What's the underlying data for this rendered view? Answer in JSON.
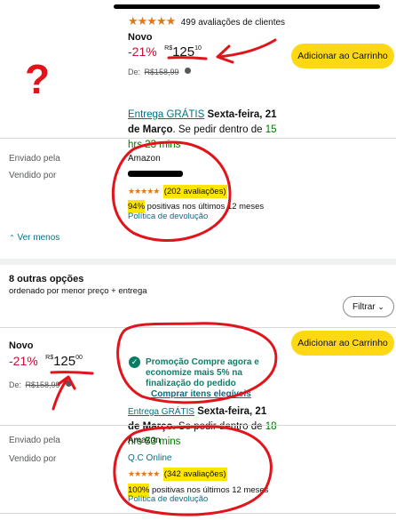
{
  "top_offer": {
    "rating_stars": "★★★★★",
    "rating_count": "499 avaliações de clientes",
    "condition": "Novo",
    "discount": "-21%",
    "currency": "R$",
    "price_whole": "125",
    "price_cents": "10",
    "list_price_label": "De:",
    "list_price": "R$158,99",
    "add_to_cart": "Adicionar ao Carrinho",
    "delivery_free": "Entrega GRÁTIS",
    "delivery_date": "Sexta-feira, 21 de Março",
    "delivery_order_text": ". Se pedir dentro de ",
    "delivery_countdown": "15 hrs 23 mins",
    "shipped_by_label": "Enviado pela",
    "shipped_by_value": "Amazon",
    "sold_by_label": "Vendido por",
    "sold_by_value": "",
    "seller_stars": "★★★★★",
    "seller_reviews": "(202 avaliações)",
    "seller_positive_pct": "94%",
    "seller_positive_text": " positivas nos últimos 12 meses",
    "return_policy": "Política de devolução",
    "see_less": "Ver menos"
  },
  "other_options": {
    "title": "8 outras opções",
    "subtitle": "ordenado por menor preço + entrega",
    "filter_label": "Filtrar"
  },
  "second_offer": {
    "condition": "Novo",
    "discount": "-21%",
    "currency": "R$",
    "price_whole": "125",
    "price_cents": "00",
    "list_price_label": "De:",
    "list_price": "R$158,99",
    "promo_text": "Promoção Compre agora e economize mais 5% na finalização do pedido",
    "promo_link": "Comprar itens elegíveis",
    "add_to_cart": "Adicionar ao Carrinho",
    "delivery_free": "Entrega GRÁTIS",
    "delivery_date": "Sexta-feira, 21 de Março",
    "delivery_order_text": ". Se pedir dentro de ",
    "delivery_countdown": "18 hrs 53 mins",
    "shipped_by_label": "Enviado pela",
    "shipped_by_value": "Amazon",
    "sold_by_label": "Vendido por",
    "sold_by_value": "Q.C Online",
    "seller_stars": "★★★★★",
    "seller_reviews": "(342 avaliações)",
    "seller_positive_pct": "100%",
    "seller_positive_text": " positivas nos últimos 12 meses",
    "return_policy": "Política de devolução"
  },
  "annotations": {
    "question_mark": "?"
  },
  "colors": {
    "star": "#de7921",
    "discount": "#cc0c39",
    "link": "#007185",
    "button": "#ffd814",
    "annotation_red": "#e1141b",
    "highlight": "#ffe500"
  }
}
